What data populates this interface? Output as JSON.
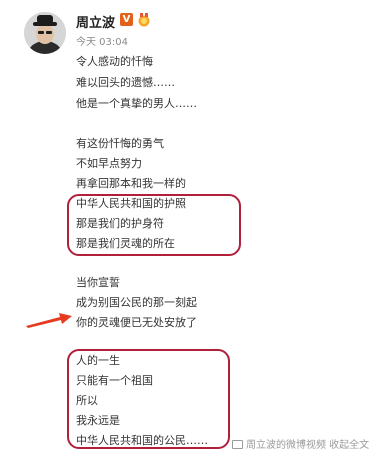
{
  "post": {
    "username": "周立波",
    "vip_badge": "V",
    "timestamp": "今天 03:04",
    "lines": [
      "令人感动的忏悔",
      "难以回头的遗憾……",
      "他是一个真挚的男人……",
      "有这份忏悔的勇气",
      "不如早点努力",
      "再拿回那本和我一样的",
      "中华人民共和国的护照",
      "那是我们的护身符",
      "那是我们灵魂的所在",
      "当你宣誓",
      "成为别国公民的那一刻起",
      "你的灵魂便已无处安放了",
      "人的一生",
      "只能有一个祖国",
      "所以",
      "我永远是",
      "中华人民共和国的公民……"
    ],
    "source_tag": "周立波的微博视频 收起全文"
  },
  "colors": {
    "highlight_box": "#b0203a",
    "arrow": "#e53a1e",
    "vip_badge": "#e2621b"
  },
  "icons": {
    "avatar": "avatar-icon",
    "vip": "vip-badge-icon",
    "level": "level-medal-icon",
    "arrow": "red-arrow-icon",
    "source": "video-source-icon"
  }
}
